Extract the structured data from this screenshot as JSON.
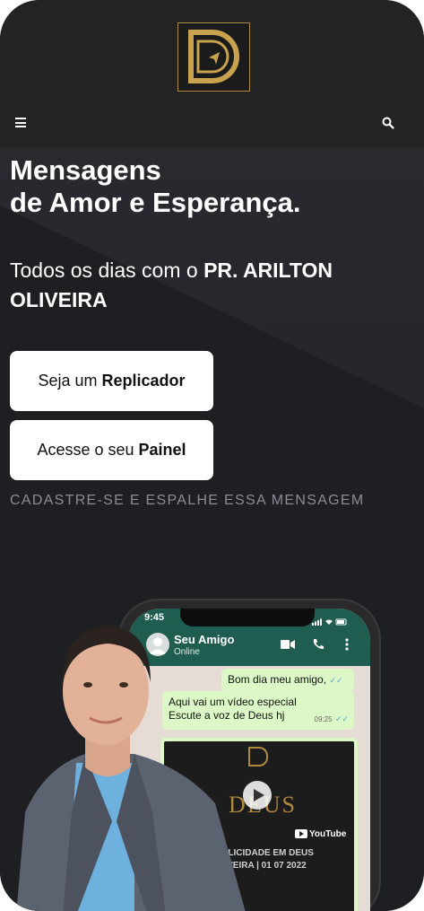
{
  "header": {
    "logo_letter": "D",
    "menu_icon": "hamburger-menu-icon",
    "search_icon": "search-icon"
  },
  "hero": {
    "title_line1": "Mensagens",
    "title_line2": "de Amor e Esperança.",
    "subtitle_prefix": "Todos os dias com o",
    "subtitle_bold": "PR. ARILTON OLIVEIRA"
  },
  "buttons": {
    "replicator_prefix": "Seja um",
    "replicator_bold": "Replicador",
    "panel_prefix": "Acesse o seu",
    "panel_bold": "Painel"
  },
  "cta": {
    "text": "CADASTRE-SE E ESPALHE ESSA MENSAGEM"
  },
  "phone": {
    "status_time": "9:45",
    "contact_name": "Seu Amigo",
    "contact_status": "Online",
    "messages": [
      {
        "text": "Bom dia meu amigo,"
      },
      {
        "line1": "Aqui vai um vídeo especial",
        "line2": "Escute a voz de Deus hj",
        "time": "09:25"
      }
    ],
    "video": {
      "title_line1": "| FELICIDADE EM DEUS",
      "title_line2": "LIVEIRA | 01 07 2022",
      "brand": "YouTube",
      "bg_text": "DEUS"
    }
  },
  "colors": {
    "accent_gold": "#b08a3c",
    "whatsapp_green": "#1f5d50",
    "bubble": "#dcf8c6",
    "background": "#1e1f22"
  }
}
